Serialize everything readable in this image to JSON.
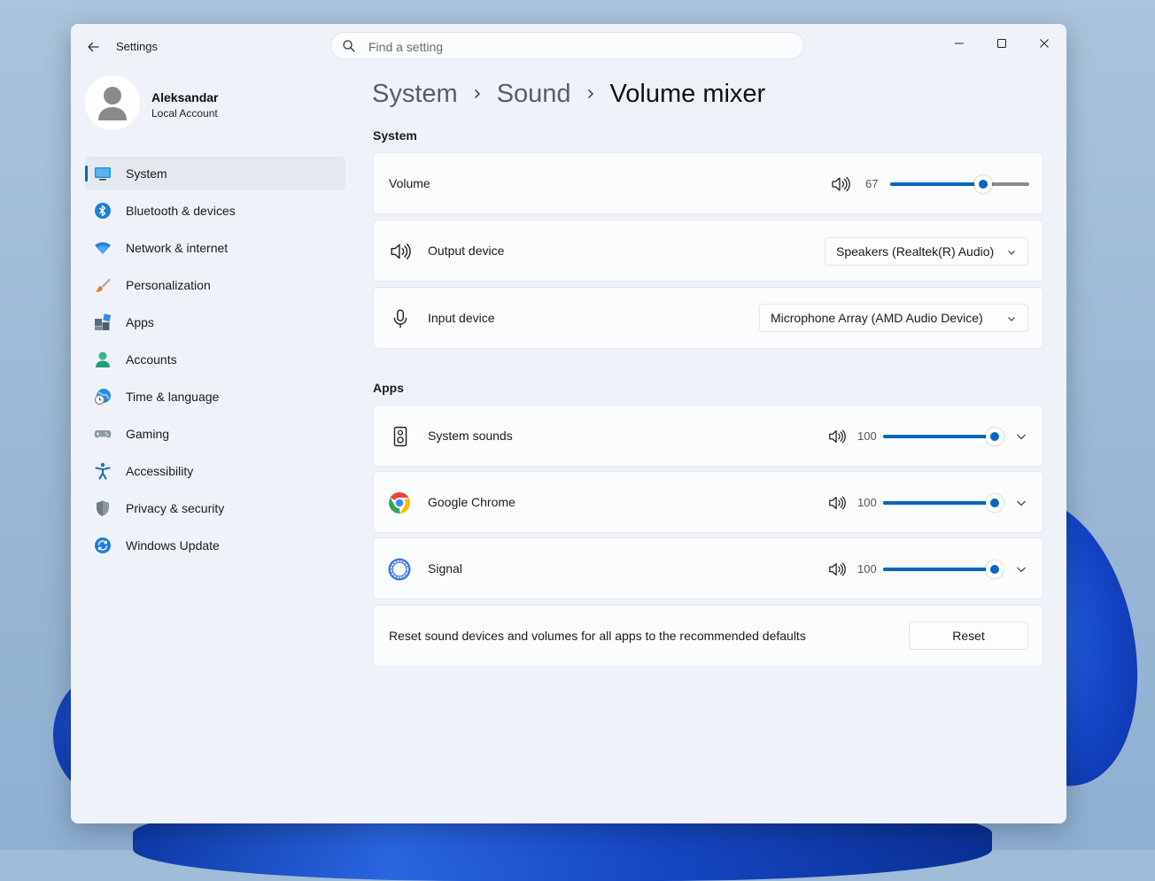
{
  "window": {
    "title": "Settings"
  },
  "search": {
    "placeholder": "Find a setting"
  },
  "profile": {
    "name": "Aleksandar",
    "account_type": "Local Account"
  },
  "sidebar": {
    "items": [
      {
        "label": "System",
        "icon": "monitor-icon",
        "active": true
      },
      {
        "label": "Bluetooth & devices",
        "icon": "bluetooth-icon"
      },
      {
        "label": "Network & internet",
        "icon": "wifi-icon"
      },
      {
        "label": "Personalization",
        "icon": "brush-icon"
      },
      {
        "label": "Apps",
        "icon": "apps-icon"
      },
      {
        "label": "Accounts",
        "icon": "person-icon"
      },
      {
        "label": "Time & language",
        "icon": "globe-clock-icon"
      },
      {
        "label": "Gaming",
        "icon": "gamepad-icon"
      },
      {
        "label": "Accessibility",
        "icon": "accessibility-icon"
      },
      {
        "label": "Privacy & security",
        "icon": "shield-icon"
      },
      {
        "label": "Windows Update",
        "icon": "update-icon"
      }
    ]
  },
  "breadcrumb": {
    "level1": "System",
    "level2": "Sound",
    "current": "Volume mixer"
  },
  "system_section": {
    "title": "System",
    "volume": {
      "label": "Volume",
      "value": "67",
      "level": 67
    },
    "output_device": {
      "label": "Output device",
      "selected": "Speakers (Realtek(R) Audio)"
    },
    "input_device": {
      "label": "Input device",
      "selected": "Microphone Array (AMD Audio Device)"
    }
  },
  "apps_section": {
    "title": "Apps",
    "apps": [
      {
        "label": "System sounds",
        "value": "100",
        "level": 100,
        "icon": "speaker-box-icon"
      },
      {
        "label": "Google Chrome",
        "value": "100",
        "level": 100,
        "icon": "chrome-icon"
      },
      {
        "label": "Signal",
        "value": "100",
        "level": 100,
        "icon": "signal-icon"
      }
    ]
  },
  "reset": {
    "description": "Reset sound devices and volumes for all apps to the recommended defaults",
    "button_label": "Reset"
  },
  "colors": {
    "accent": "#0067c0",
    "window_bg": "#eff3f9",
    "card_bg": "#fbfcfd"
  }
}
